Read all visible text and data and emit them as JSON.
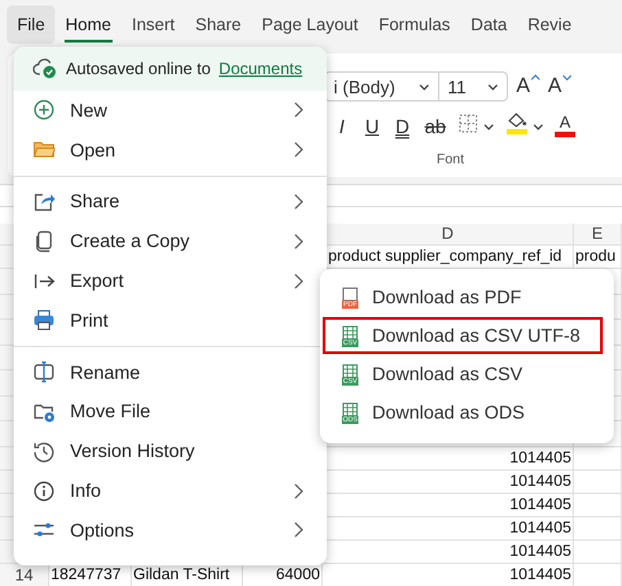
{
  "file_button": {
    "label": "File",
    "pressed": true
  },
  "tabs": [
    {
      "label": "Home",
      "selected": true
    },
    {
      "label": "Insert",
      "selected": false
    },
    {
      "label": "Share",
      "selected": false
    },
    {
      "label": "Page Layout",
      "selected": false
    },
    {
      "label": "Formulas",
      "selected": false
    },
    {
      "label": "Data",
      "selected": false
    },
    {
      "label": "Revie",
      "selected": false
    }
  ],
  "font_group": {
    "font_name": "i (Body)",
    "font_size": "11",
    "label": "Font",
    "buttons": [
      {
        "kind": "grow",
        "glyph": "A"
      },
      {
        "kind": "shrink",
        "glyph": "A"
      },
      {
        "kind": "italic",
        "glyph": "I"
      },
      {
        "kind": "underline",
        "glyph": "U"
      },
      {
        "kind": "double-underline",
        "glyph": "D"
      },
      {
        "kind": "strike",
        "glyph": "ab"
      },
      {
        "kind": "borders"
      },
      {
        "kind": "fill"
      },
      {
        "kind": "font-color",
        "glyph": "A"
      }
    ]
  },
  "sheet": {
    "column_headers": {
      "col_4": "D",
      "col_5": "E"
    },
    "rows": [
      {
        "col_4": "product supplier_company_ref_id",
        "col_5": "produ"
      },
      {},
      {},
      {},
      {},
      {},
      {},
      {},
      {
        "col_4": "1014405"
      },
      {
        "col_4": "1014405"
      },
      {
        "col_4": "1014405"
      },
      {
        "col_4": "1014405"
      },
      {
        "col_4": "1014405"
      },
      {
        "number": "14",
        "col_1": "18247737",
        "col_2": "Gildan T-Shirt",
        "col_3": "64000",
        "col_4": "1014405"
      }
    ]
  },
  "file_menu": {
    "status": {
      "text": "Autosaved online to",
      "link": "Documents"
    },
    "sections": [
      [
        {
          "label": "New",
          "submenu": true
        },
        {
          "label": "Open",
          "submenu": true
        }
      ],
      [
        {
          "label": "Share",
          "submenu": true
        },
        {
          "label": "Create a Copy",
          "submenu": true
        },
        {
          "label": "Export",
          "submenu": true
        },
        {
          "label": "Print",
          "submenu": false
        }
      ],
      [
        {
          "label": "Rename",
          "submenu": false
        },
        {
          "label": "Move File",
          "submenu": false
        },
        {
          "label": "Version History",
          "submenu": false
        },
        {
          "label": "Info",
          "submenu": true
        },
        {
          "label": "Options",
          "submenu": true
        }
      ]
    ]
  },
  "export_submenu": {
    "items": [
      {
        "label": "Download as PDF",
        "file_type": "PDF",
        "highlighted": false
      },
      {
        "label": "Download as CSV UTF-8",
        "file_type": "CSV",
        "highlighted": true
      },
      {
        "label": "Download as CSV",
        "file_type": "CSV",
        "highlighted": false
      },
      {
        "label": "Download as ODS",
        "file_type": "ODS",
        "highlighted": false
      }
    ]
  }
}
